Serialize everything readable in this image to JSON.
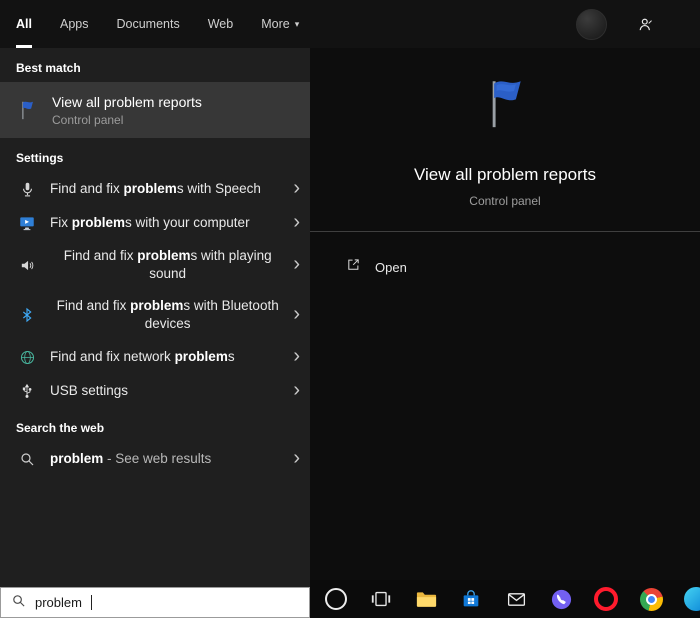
{
  "tabs": {
    "all": "All",
    "apps": "Apps",
    "documents": "Documents",
    "web": "Web",
    "more": "More"
  },
  "sections": {
    "best_match": "Best match",
    "settings": "Settings",
    "search_the_web": "Search the web"
  },
  "best_match": {
    "title": "View all problem reports",
    "subtitle": "Control panel"
  },
  "settings_items": [
    {
      "pre": "Find and fix ",
      "bold": "problem",
      "post": "s with Speech"
    },
    {
      "pre": "Fix ",
      "bold": "problem",
      "post": "s with your computer"
    },
    {
      "pre": "Find and fix ",
      "bold": "problem",
      "post": "s with playing sound"
    },
    {
      "pre": "Find and fix ",
      "bold": "problem",
      "post": "s with Bluetooth devices"
    },
    {
      "pre": "Find and fix network ",
      "bold": "problem",
      "post": "s"
    },
    {
      "pre": "USB settings",
      "bold": "",
      "post": ""
    }
  ],
  "web_item": {
    "bold": "problem",
    "rest": " - See web results"
  },
  "preview": {
    "title": "View all problem reports",
    "subtitle": "Control panel",
    "open_label": "Open"
  },
  "search": {
    "value": "problem"
  },
  "glyphs": {
    "chevron": "›",
    "caret": "▾"
  },
  "icons": {
    "best_match": "flag-icon",
    "settings": [
      "microphone-icon",
      "computer-icon",
      "speaker-icon",
      "bluetooth-icon",
      "network-icon",
      "usb-icon"
    ],
    "web": "search-icon",
    "preview": "flag-icon",
    "open": "open-icon",
    "topbar": [
      "avatar",
      "feedback-icon"
    ],
    "search_box": "search-icon",
    "taskbar": [
      "cortana-icon",
      "task-view-icon",
      "file-explorer-icon",
      "store-icon",
      "mail-icon",
      "viber-icon",
      "opera-icon",
      "chrome-icon",
      "edge-icon"
    ]
  },
  "colors": {
    "left_panel_bg": "#1f1f1f",
    "selected_item_bg": "#373737",
    "right_panel_bg": "#0d0d0d",
    "topbar_bg": "#121212",
    "taskbar_bg": "#0b0b0b",
    "search_box_bg": "#ffffff",
    "tab_underline": "#ffffff",
    "flag_blue": "#2b5fc7",
    "bluetooth_blue": "#3fa9f5",
    "folder_yellow": "#ffd96a",
    "store_blue": "#0f78d7",
    "viber_purple": "#7360f2",
    "opera_red": "#ff1b2d",
    "chrome_red": "#ea4335",
    "chrome_yellow": "#fbbc05",
    "chrome_green": "#34a853",
    "chrome_blue": "#4285f4",
    "edge_blue": "#0a84d6"
  }
}
